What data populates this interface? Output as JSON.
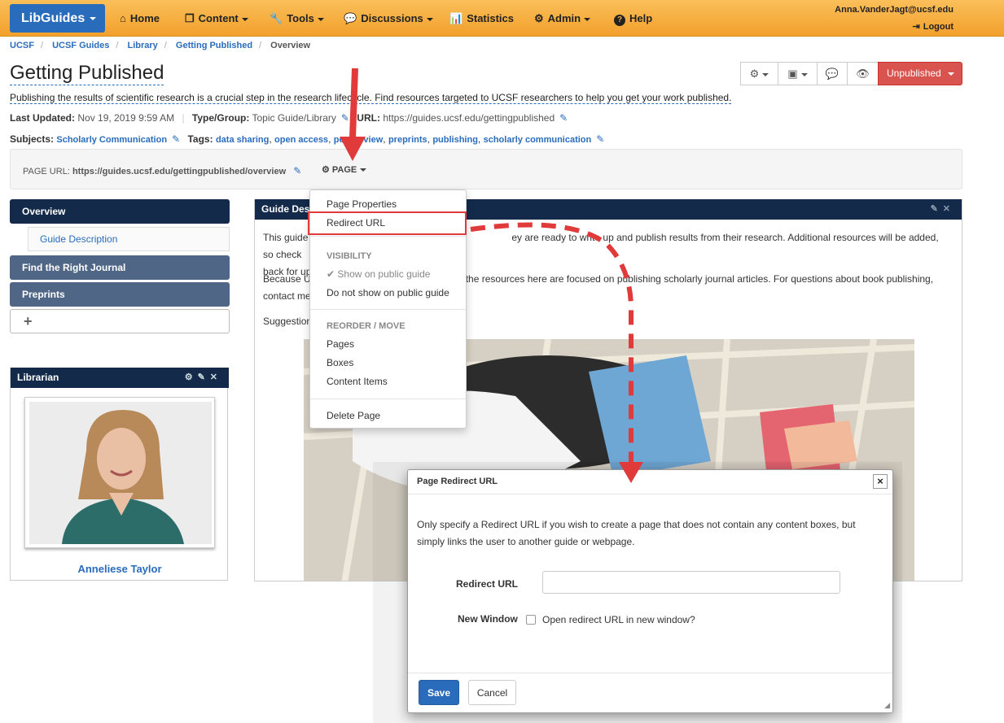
{
  "nav": {
    "brand": "LibGuides",
    "items": [
      {
        "label": "Home",
        "icon": "home-icon",
        "glyph": "⌂"
      },
      {
        "label": "Content",
        "icon": "content-icon",
        "glyph": "❐"
      },
      {
        "label": "Tools",
        "icon": "wrench-icon",
        "glyph": "🔧"
      },
      {
        "label": "Discussions",
        "icon": "comments-icon",
        "glyph": "💬"
      },
      {
        "label": "Statistics",
        "icon": "bar-chart-icon",
        "glyph": "📊"
      },
      {
        "label": "Admin",
        "icon": "sitemap-icon",
        "glyph": "⚙"
      },
      {
        "label": "Help",
        "icon": "question-icon",
        "glyph": "?"
      }
    ],
    "user_email": "Anna.VanderJagt@ucsf.edu",
    "logout": "Logout"
  },
  "breadcrumb": [
    "UCSF",
    "UCSF Guides",
    "Library",
    "Getting Published",
    "Overview"
  ],
  "guide": {
    "title": "Getting Published",
    "description": "Publishing the results of scientific research is a crucial step in the research lifecycle. Find resources targeted to UCSF researchers to help you get your work published.",
    "last_updated_label": "Last Updated:",
    "last_updated": "Nov 19, 2019 9:59 AM",
    "type_label": "Type/Group:",
    "type": "Topic Guide/Library",
    "url_label": "URL:",
    "url": "https://guides.ucsf.edu/gettingpublished",
    "subjects_label": "Subjects:",
    "subjects": "Scholarly Communication",
    "tags_label": "Tags:",
    "tags": [
      "data sharing",
      "open access",
      "peer review",
      "preprints",
      "publishing",
      "scholarly communication"
    ]
  },
  "toolbar": {
    "unpublished": "Unpublished"
  },
  "page_url": {
    "label": "PAGE URL:",
    "value": "https://guides.ucsf.edu/gettingpublished/overview",
    "page_menu": "PAGE"
  },
  "left_nav": {
    "overview": "Overview",
    "guide_description": "Guide Description",
    "find_journal": "Find the Right Journal",
    "preprints": "Preprints",
    "add": "+"
  },
  "librarian": {
    "heading": "Librarian",
    "name": "Anneliese Taylor"
  },
  "main": {
    "box_title": "Guide Des",
    "para1a": "This guide",
    "para1b": "ey are ready to write up and publish results from their research. Additional resources will be added, so check",
    "para1c": "back for up",
    "para2a": "Because U",
    "para2b": "the resources here are focused on publishing scholarly journal articles. For questions about book publishing,",
    "para2c": "contact me",
    "para3": "Suggestion"
  },
  "dropdown": {
    "page_properties": "Page Properties",
    "redirect_url": "Redirect URL",
    "visibility_head": "VISIBILITY",
    "show_public": "Show on public guide",
    "hide_public": "Do not show on public guide",
    "reorder_head": "REORDER / MOVE",
    "pages": "Pages",
    "boxes": "Boxes",
    "content_items": "Content Items",
    "delete_page": "Delete Page"
  },
  "modal": {
    "title": "Page Redirect URL",
    "close": "×",
    "body": "Only specify a Redirect URL if you wish to create a page that does not contain any content boxes, but simply links the user to another guide or webpage.",
    "redirect_label": "Redirect URL",
    "redirect_value": "",
    "new_window_label": "New Window",
    "new_window_option": "Open redirect URL in new window?",
    "save": "Save",
    "cancel": "Cancel"
  },
  "colors": {
    "navbar": "#f5a940",
    "brand": "#2a6cbc",
    "nav_dark": "#132a4b",
    "nav_item": "#4f6687",
    "danger": "#d9534f",
    "annotation": "#e03a3a"
  }
}
